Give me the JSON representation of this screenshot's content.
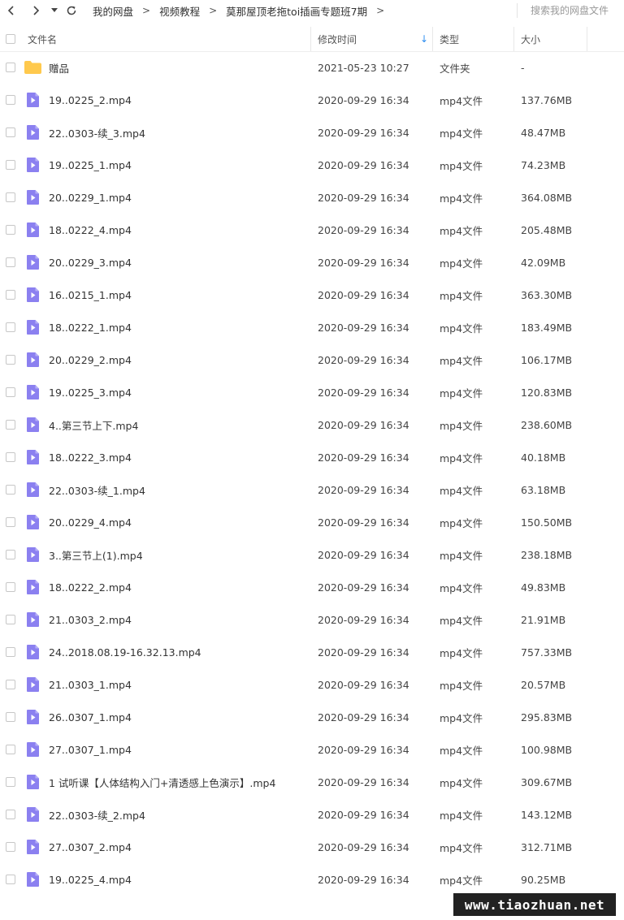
{
  "breadcrumb": [
    "我的网盘",
    "视频教程",
    "莫那屋顶老拖toi插画专题班7期"
  ],
  "breadcrumb_sep": ">",
  "search": {
    "placeholder": "搜索我的网盘文件"
  },
  "columns": {
    "name": "文件名",
    "mtime": "修改时间",
    "type": "类型",
    "size": "大小"
  },
  "sort_indicator": "↓",
  "accent_color": "#2f8ef0",
  "folder_color": "#ffc94d",
  "video_icon_color": "#8b80f0",
  "rows": [
    {
      "icon": "folder",
      "name": "赠品",
      "mtime": "2021-05-23 10:27",
      "type": "文件夹",
      "size": "-"
    },
    {
      "icon": "video",
      "name": "19..0225_2.mp4",
      "mtime": "2020-09-29 16:34",
      "type": "mp4文件",
      "size": "137.76MB"
    },
    {
      "icon": "video",
      "name": "22..0303-续_3.mp4",
      "mtime": "2020-09-29 16:34",
      "type": "mp4文件",
      "size": "48.47MB"
    },
    {
      "icon": "video",
      "name": "19..0225_1.mp4",
      "mtime": "2020-09-29 16:34",
      "type": "mp4文件",
      "size": "74.23MB"
    },
    {
      "icon": "video",
      "name": "20..0229_1.mp4",
      "mtime": "2020-09-29 16:34",
      "type": "mp4文件",
      "size": "364.08MB"
    },
    {
      "icon": "video",
      "name": "18..0222_4.mp4",
      "mtime": "2020-09-29 16:34",
      "type": "mp4文件",
      "size": "205.48MB"
    },
    {
      "icon": "video",
      "name": "20..0229_3.mp4",
      "mtime": "2020-09-29 16:34",
      "type": "mp4文件",
      "size": "42.09MB"
    },
    {
      "icon": "video",
      "name": "16..0215_1.mp4",
      "mtime": "2020-09-29 16:34",
      "type": "mp4文件",
      "size": "363.30MB"
    },
    {
      "icon": "video",
      "name": "18..0222_1.mp4",
      "mtime": "2020-09-29 16:34",
      "type": "mp4文件",
      "size": "183.49MB"
    },
    {
      "icon": "video",
      "name": "20..0229_2.mp4",
      "mtime": "2020-09-29 16:34",
      "type": "mp4文件",
      "size": "106.17MB"
    },
    {
      "icon": "video",
      "name": "19..0225_3.mp4",
      "mtime": "2020-09-29 16:34",
      "type": "mp4文件",
      "size": "120.83MB"
    },
    {
      "icon": "video",
      "name": "4..第三节上下.mp4",
      "mtime": "2020-09-29 16:34",
      "type": "mp4文件",
      "size": "238.60MB"
    },
    {
      "icon": "video",
      "name": "18..0222_3.mp4",
      "mtime": "2020-09-29 16:34",
      "type": "mp4文件",
      "size": "40.18MB"
    },
    {
      "icon": "video",
      "name": "22..0303-续_1.mp4",
      "mtime": "2020-09-29 16:34",
      "type": "mp4文件",
      "size": "63.18MB"
    },
    {
      "icon": "video",
      "name": "20..0229_4.mp4",
      "mtime": "2020-09-29 16:34",
      "type": "mp4文件",
      "size": "150.50MB"
    },
    {
      "icon": "video",
      "name": "3..第三节上(1).mp4",
      "mtime": "2020-09-29 16:34",
      "type": "mp4文件",
      "size": "238.18MB"
    },
    {
      "icon": "video",
      "name": "18..0222_2.mp4",
      "mtime": "2020-09-29 16:34",
      "type": "mp4文件",
      "size": "49.83MB"
    },
    {
      "icon": "video",
      "name": "21..0303_2.mp4",
      "mtime": "2020-09-29 16:34",
      "type": "mp4文件",
      "size": "21.91MB"
    },
    {
      "icon": "video",
      "name": "24..2018.08.19-16.32.13.mp4",
      "mtime": "2020-09-29 16:34",
      "type": "mp4文件",
      "size": "757.33MB"
    },
    {
      "icon": "video",
      "name": "21..0303_1.mp4",
      "mtime": "2020-09-29 16:34",
      "type": "mp4文件",
      "size": "20.57MB"
    },
    {
      "icon": "video",
      "name": "26..0307_1.mp4",
      "mtime": "2020-09-29 16:34",
      "type": "mp4文件",
      "size": "295.83MB"
    },
    {
      "icon": "video",
      "name": "27..0307_1.mp4",
      "mtime": "2020-09-29 16:34",
      "type": "mp4文件",
      "size": "100.98MB"
    },
    {
      "icon": "video",
      "name": "1 试听课【人体结构入门+清透感上色演示】.mp4",
      "mtime": "2020-09-29 16:34",
      "type": "mp4文件",
      "size": "309.67MB"
    },
    {
      "icon": "video",
      "name": "22..0303-续_2.mp4",
      "mtime": "2020-09-29 16:34",
      "type": "mp4文件",
      "size": "143.12MB"
    },
    {
      "icon": "video",
      "name": "27..0307_2.mp4",
      "mtime": "2020-09-29 16:34",
      "type": "mp4文件",
      "size": "312.71MB"
    },
    {
      "icon": "video",
      "name": "19..0225_4.mp4",
      "mtime": "2020-09-29 16:34",
      "type": "mp4文件",
      "size": "90.25MB"
    }
  ],
  "watermark": "www.tiaozhuan.net"
}
